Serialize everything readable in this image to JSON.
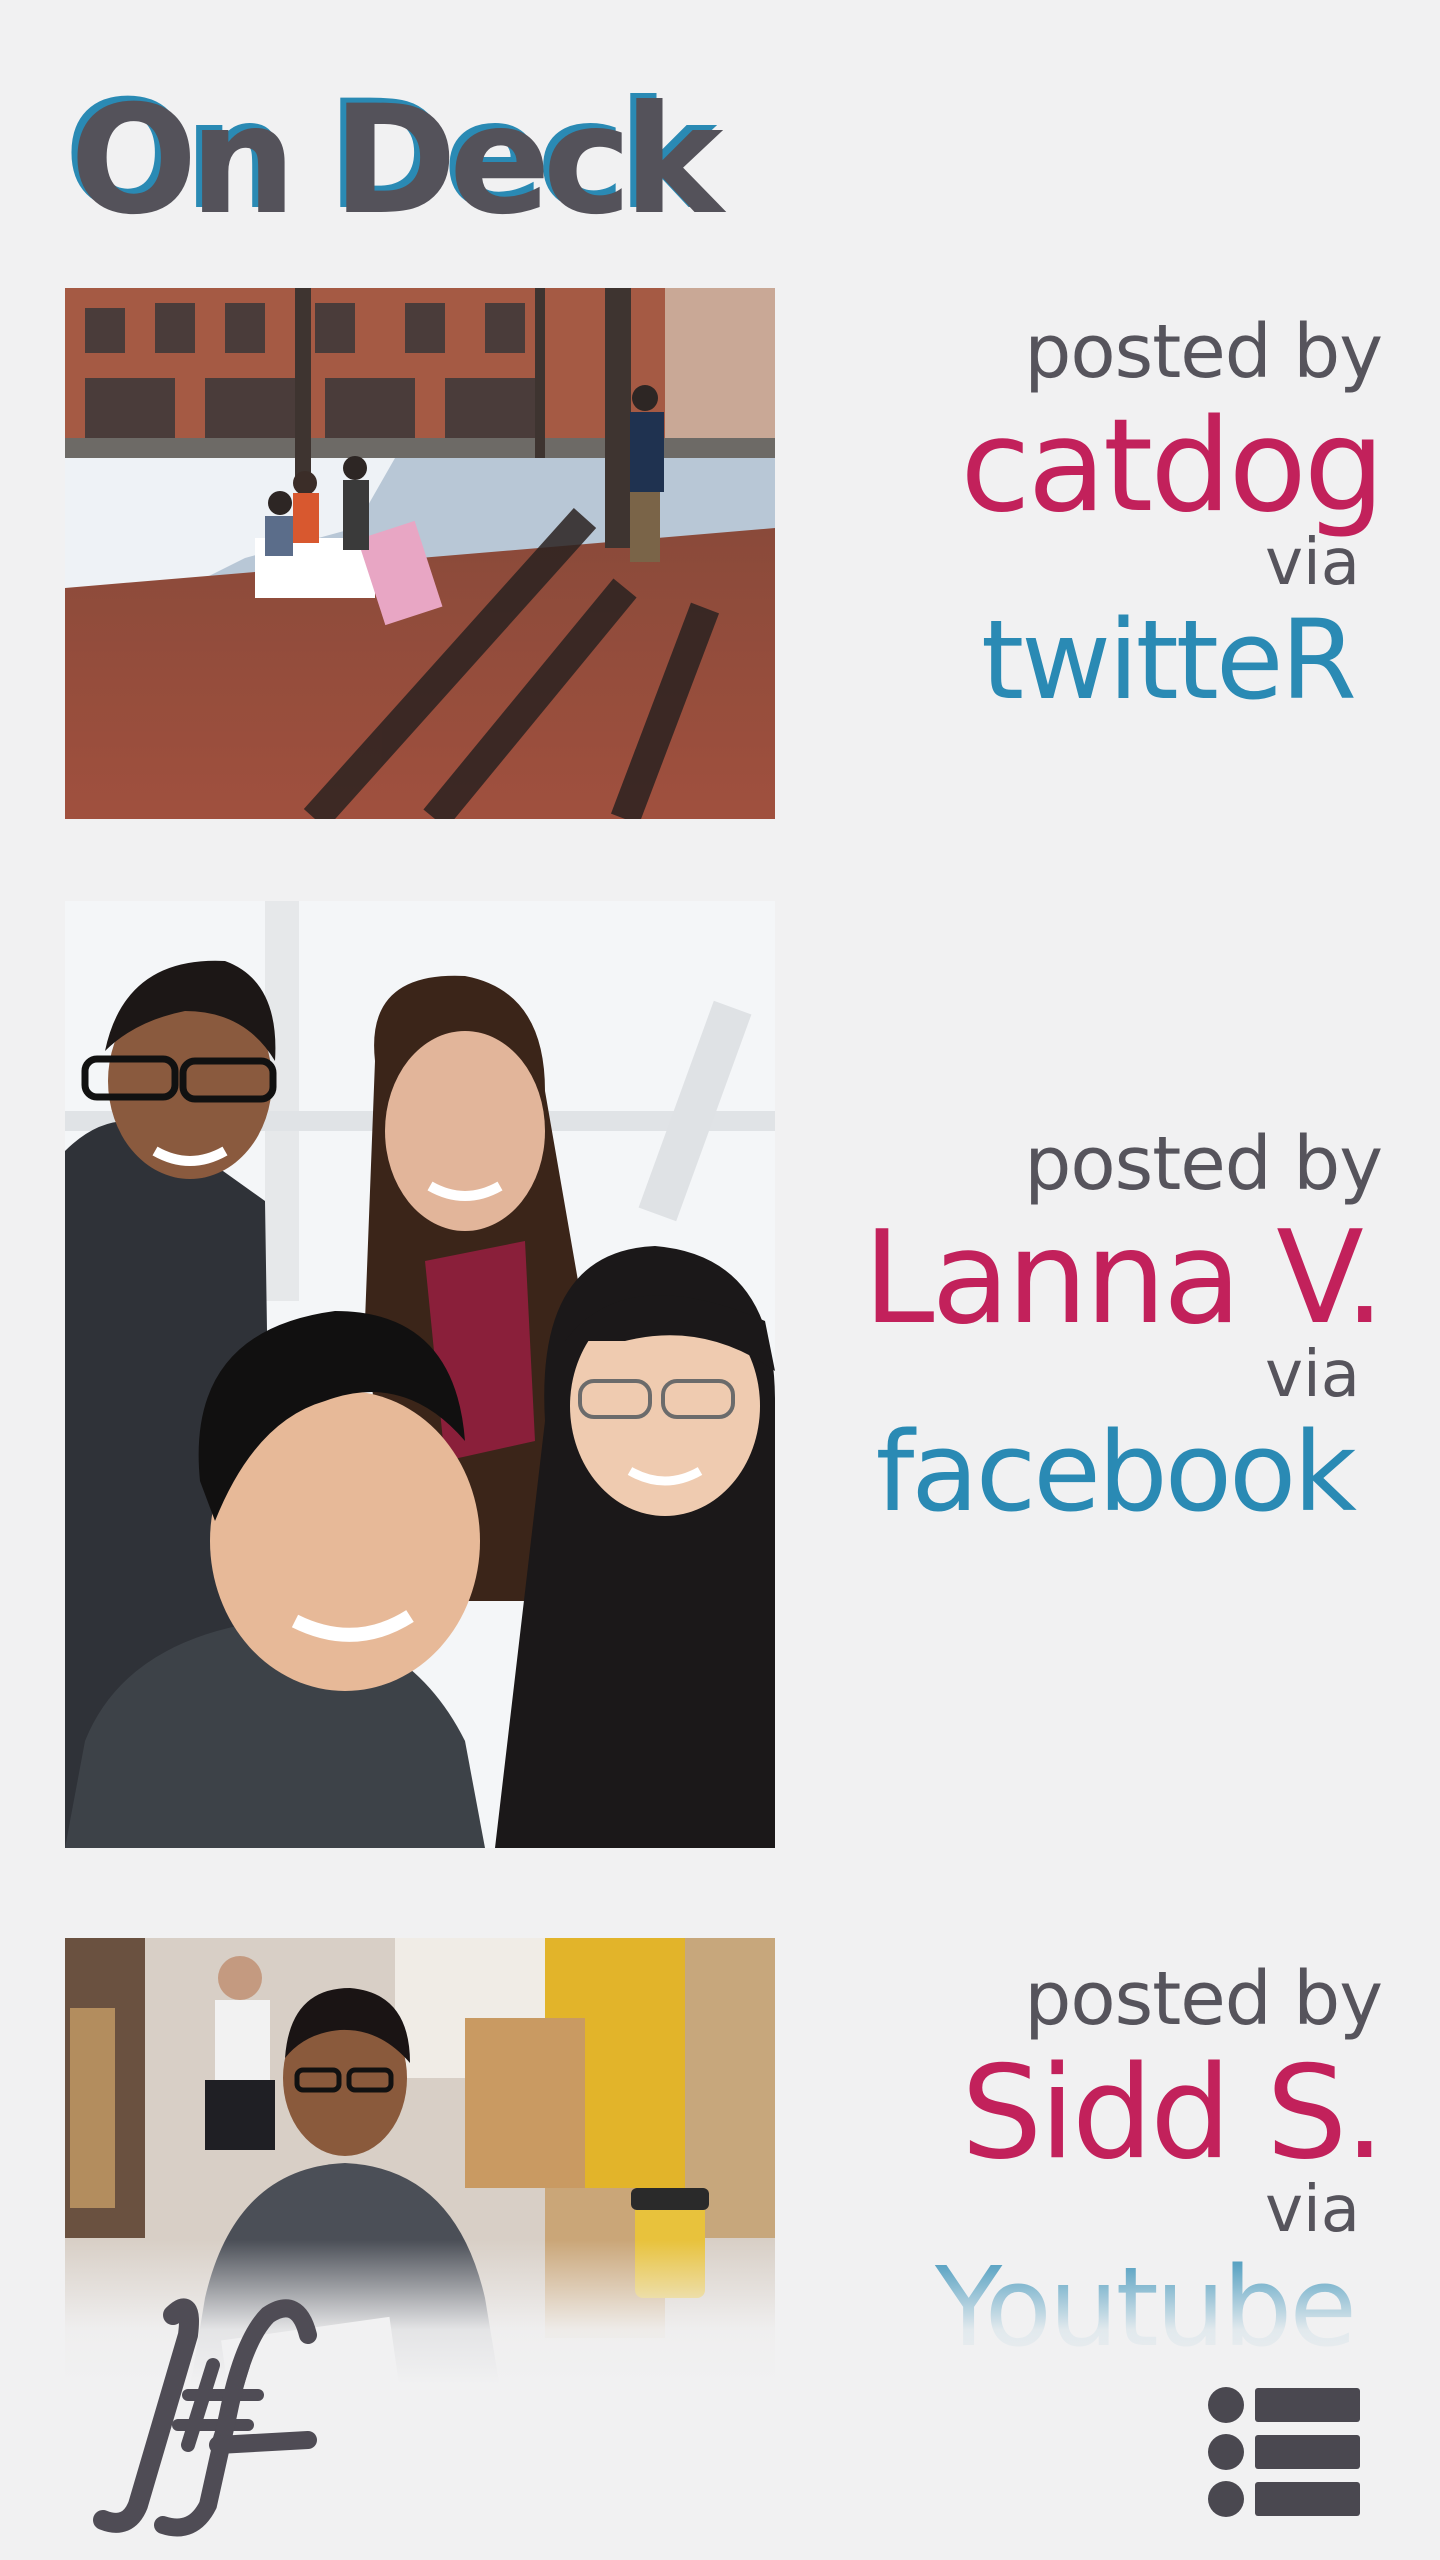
{
  "header": {
    "title": "On Deck"
  },
  "posts": [
    {
      "posted_by_label": "posted by",
      "author": "catdog",
      "via_label": "via",
      "source": "twitteR"
    },
    {
      "posted_by_label": "posted by",
      "author": "Lanna V.",
      "via_label": "via",
      "source": "facebook"
    },
    {
      "posted_by_label": "posted by",
      "author": "Sidd S.",
      "via_label": "via",
      "source": "Youtube"
    }
  ],
  "footer": {
    "logo_icon": "hf-monogram-logo",
    "menu_icon": "list-menu-icon"
  },
  "colors": {
    "background": "#f1f1f2",
    "author_accent": "#c2215b",
    "source_accent": "#2a8ab4",
    "text_gray": "#56545c"
  }
}
